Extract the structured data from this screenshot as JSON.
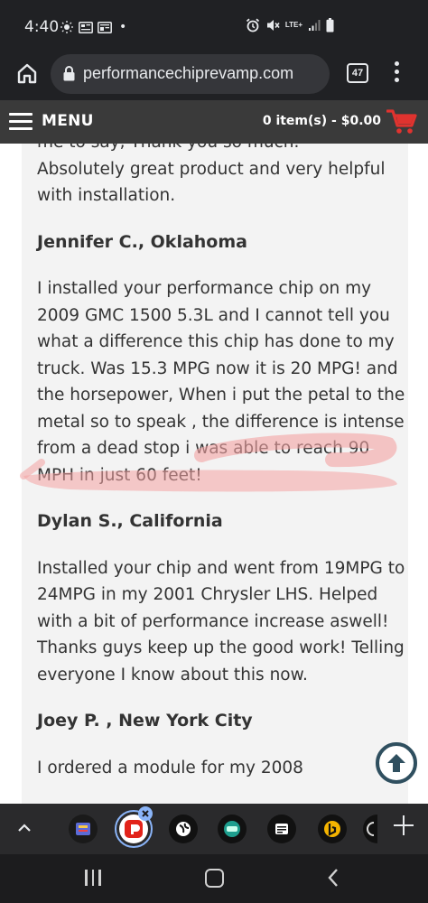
{
  "status_bar": {
    "time": "4:40",
    "dot": "•",
    "network": "LTE+"
  },
  "browser": {
    "url": "performancechiprevamp.com",
    "tab_count": "47"
  },
  "site_nav": {
    "menu_label": "MENU",
    "cart_text": "0 item(s) - $0.00"
  },
  "content": {
    "partial_top": "me to say, Thank you so much.",
    "review0_end": "Absolutely great product and very helpful with installation.",
    "reviews": [
      {
        "name": "Jennifer C., Oklahoma",
        "text": "I installed your performance chip on my 2009 GMC 1500 5.3L and I cannot tell you what a difference this chip has done to my truck. Was 15.3 MPG now it is 20 MPG! and the horsepower, When i put the petal to the metal so to speak , the difference is intense from a dead stop i was able to reach 90 MPH in just 60 feet!"
      },
      {
        "name": "Dylan S., California",
        "text": "Installed your chip and went from 19MPG to 24MPG in my 2001 Chrysler LHS. Helped with a bit of performance increase aswell! Thanks guys keep up the good work! Telling everyone I know about this now."
      },
      {
        "name": "Joey P. , New York City",
        "text": "I ordered a module for my 2008"
      }
    ]
  },
  "colors": {
    "nav_bar": "#3a3a3a",
    "cart_red": "#e0332f",
    "highlight": "#f4a3a3",
    "scroll_btn": "#2f4f5f"
  },
  "icons": {
    "home": "home-icon",
    "lock": "lock-icon",
    "menu": "hamburger-icon",
    "cart": "cart-icon",
    "scroll_top": "arrow-up-circle-icon",
    "dock_apps": [
      "news-app-icon",
      "pocketcasts-app-icon",
      "browser-app-icon",
      "chat-app-icon",
      "reader-app-icon",
      "bing-app-icon",
      "partial-app-icon"
    ]
  }
}
